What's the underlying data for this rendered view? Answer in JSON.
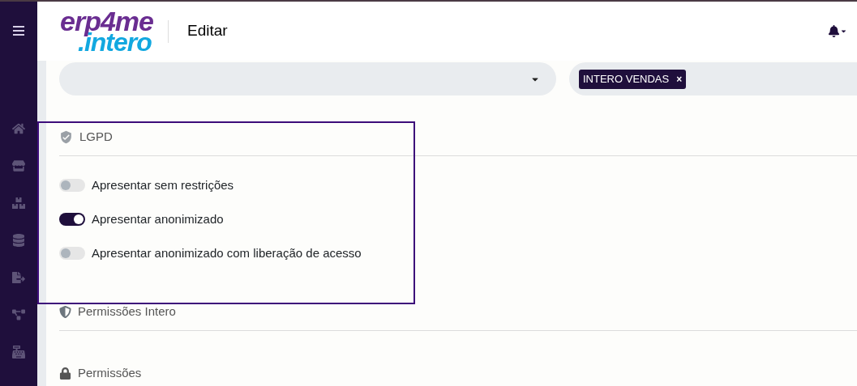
{
  "logo": {
    "top": "erp4me",
    "bottom": ".intero"
  },
  "page_title": "Editar",
  "filters": [
    {
      "kind": "select"
    },
    {
      "kind": "tags",
      "tags": [
        "INTERO VENDAS"
      ],
      "remove": "×"
    }
  ],
  "sections": [
    {
      "kind": "lgpd",
      "title": "LGPD",
      "highlighted": true,
      "options": [
        {
          "label": "Apresentar sem restrições",
          "on": false
        },
        {
          "label": "Apresentar anonimizado",
          "on": true
        },
        {
          "label": "Apresentar anonimizado com liberação de acesso",
          "on": false
        }
      ]
    },
    {
      "kind": "intero",
      "title": "Permissões Intero",
      "highlighted": false
    },
    {
      "kind": "lock",
      "title": "Permissões",
      "highlighted": false
    }
  ]
}
